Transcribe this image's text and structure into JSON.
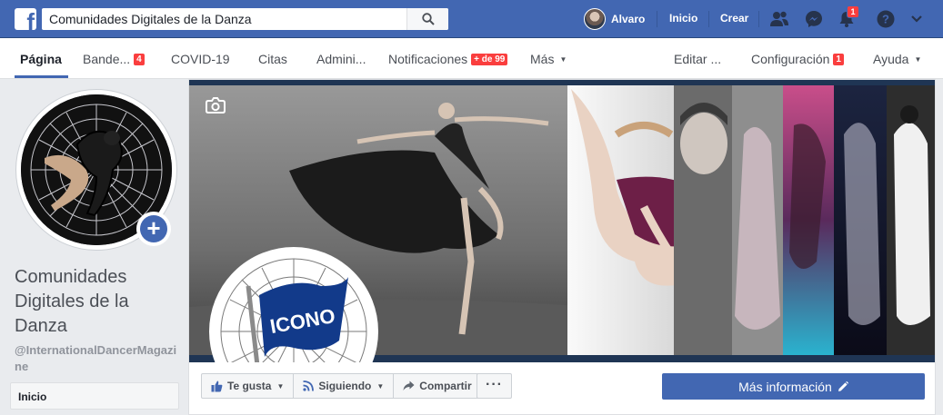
{
  "topbar": {
    "logo": "f",
    "search_value": "Comunidades Digitales de la Danza",
    "user_name": "Alvaro",
    "home_label": "Inicio",
    "create_label": "Crear",
    "notifications_count": "1"
  },
  "pagenav": {
    "tabs": [
      {
        "label": "Página"
      },
      {
        "label": "Bande...",
        "badge": "4"
      },
      {
        "label": "COVID-19"
      },
      {
        "label": "Citas"
      },
      {
        "label": "Admini..."
      },
      {
        "label": "Notificaciones",
        "badge": "+ de 99"
      },
      {
        "label": "Más"
      }
    ],
    "right": [
      {
        "label": "Editar ..."
      },
      {
        "label": "Configuración",
        "badge": "1"
      },
      {
        "label": "Ayuda"
      }
    ]
  },
  "left": {
    "page_name": "Comunidades Digitales de la Danza",
    "page_handle": "@InternationalDancerMagazine",
    "side_items": [
      {
        "label": "Inicio"
      }
    ]
  },
  "cover": {
    "logo_text": "ICONO"
  },
  "actions": {
    "like": "Te gusta",
    "following": "Siguiendo",
    "share": "Compartir",
    "more": "···",
    "cta": "Más información"
  },
  "colors": {
    "brand": "#4267b2",
    "badge": "#fa3e3e"
  }
}
